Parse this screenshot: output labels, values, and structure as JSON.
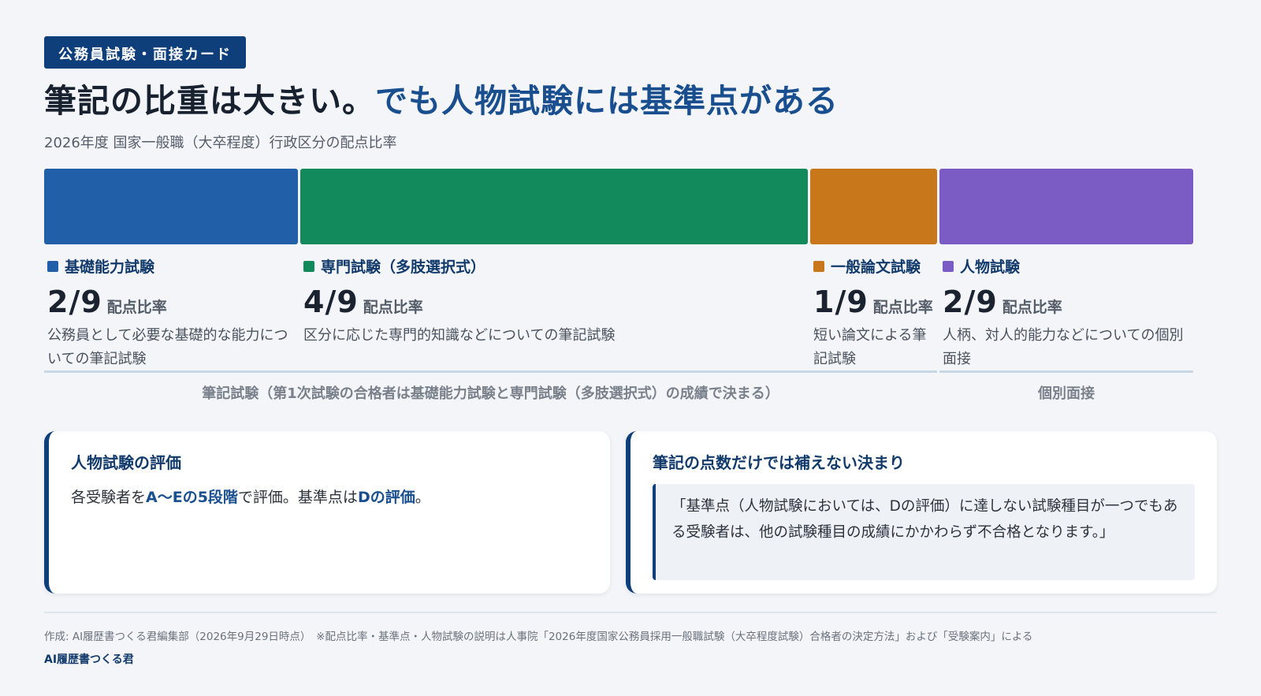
{
  "tag": "公務員試験・面接カード",
  "title": {
    "part1": "筆記の比重は大きい。",
    "part2": "でも人物試験には基準点がある"
  },
  "subtitle": "2026年度 国家一般職（大卒程度）行政区分の配点比率",
  "chart_data": {
    "type": "bar",
    "orientation": "horizontal-stacked",
    "total": 9,
    "unit_label": "配点比率",
    "segments": [
      {
        "name": "基礎能力試験",
        "value": 2,
        "fraction": "2/9",
        "color": "#2160a8",
        "description": "公務員として必要な基礎的な能力についての筆記試験"
      },
      {
        "name": "専門試験（多肢選択式）",
        "value": 4,
        "fraction": "4/9",
        "color": "#128a5c",
        "description": "区分に応じた専門的知識などについての筆記試験"
      },
      {
        "name": "一般論文試験",
        "value": 1,
        "fraction": "1/9",
        "color": "#c8781b",
        "description": "短い論文による筆記試験"
      },
      {
        "name": "人物試験",
        "value": 2,
        "fraction": "2/9",
        "color": "#7b5bc4",
        "description": "人柄、対人的能力などについての個別面接"
      }
    ],
    "groups": [
      {
        "label": "筆記試験（第1次試験の合格者は基礎能力試験と専門試験（多肢選択式）の成績で決まる）",
        "segments": [
          0,
          1,
          2
        ]
      },
      {
        "label": "個別面接",
        "segments": [
          3
        ]
      }
    ]
  },
  "card_left": {
    "title": "人物試験の評価",
    "text_a": "各受験者を",
    "text_b": "A～Eの5段階",
    "text_c": "で評価。基準点は",
    "text_d": "Dの評価",
    "text_e": "。"
  },
  "card_right": {
    "title": "筆記の点数だけでは補えない決まり",
    "quote": "「基準点（人物試験においては、Dの評価）に達しない試験種目が一つでもある受験者は、他の試験種目の成績にかかわらず不合格となります。」"
  },
  "footer": {
    "note": "作成: AI履歴書つくる君編集部（2026年9月29日時点）　※配点比率・基準点・人物試験の説明は人事院「2026年度国家公務員採用一般職試験（大卒程度試験）合格者の決定方法」および「受験案内」による",
    "brand": "AI履歴書つくる君"
  }
}
